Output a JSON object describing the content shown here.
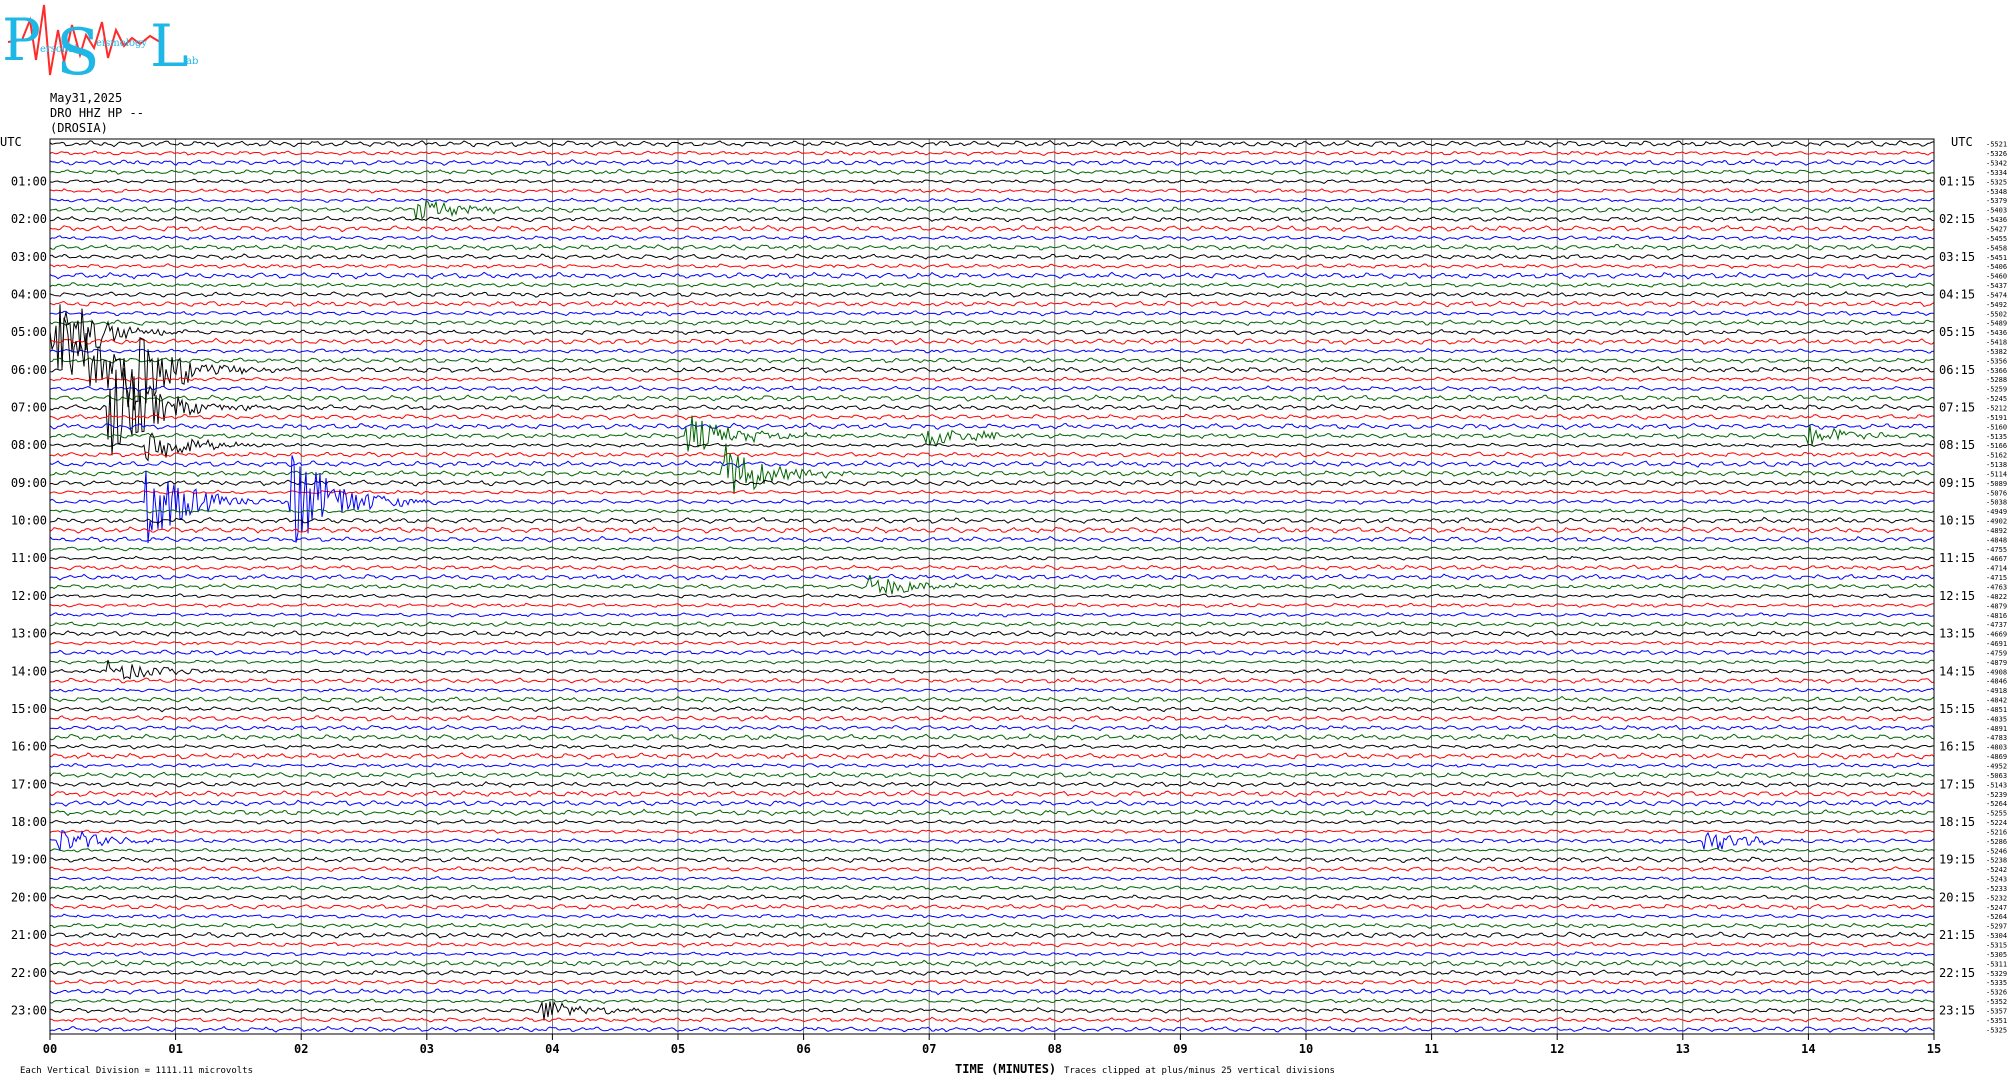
{
  "logo": {
    "initial_p": "P",
    "initial_s": "S",
    "initial_l": "L",
    "fragment_a": "ersonal",
    "fragment_b": "eismology",
    "fragment_c": "ab"
  },
  "header": {
    "date": "May31,2025",
    "channel": "DRO HHZ HP --",
    "station": "(DROSIA)"
  },
  "chart_data": {
    "type": "line",
    "title": "May31,2025 DRO HHZ HP -- (DROSIA)",
    "xlabel": "TIME (MINUTES)",
    "ylabel": "UTC",
    "xlim": [
      0,
      15
    ],
    "x_ticks": [
      "00",
      "01",
      "02",
      "03",
      "04",
      "05",
      "06",
      "07",
      "08",
      "09",
      "10",
      "11",
      "12",
      "13",
      "14",
      "15"
    ],
    "left_axis_label": "UTC",
    "right_axis_label": "UTC",
    "left_ticks": [
      "01:00",
      "02:00",
      "03:00",
      "04:00",
      "05:00",
      "06:00",
      "07:00",
      "08:00",
      "09:00",
      "10:00",
      "11:00",
      "12:00",
      "13:00",
      "14:00",
      "15:00",
      "16:00",
      "17:00",
      "18:00",
      "19:00",
      "20:00",
      "21:00",
      "22:00",
      "23:00"
    ],
    "right_ticks": [
      "01:15",
      "02:15",
      "03:15",
      "04:15",
      "05:15",
      "06:15",
      "07:15",
      "08:15",
      "09:15",
      "10:15",
      "11:15",
      "12:15",
      "13:15",
      "14:15",
      "15:15",
      "16:15",
      "17:15",
      "18:15",
      "19:15",
      "20:15",
      "21:15",
      "22:15",
      "23:15"
    ],
    "trace_colors": [
      "#000000",
      "#ff0000",
      "#0000ff",
      "#006400"
    ],
    "traces_per_hour": 4,
    "minutes_per_trace": 15,
    "trace_offsets": [
      "-5521",
      "-5326",
      "-5342",
      "-5334",
      "-5325",
      "-5348",
      "-5379",
      "-5403",
      "-5436",
      "-5427",
      "-5455",
      "-5458",
      "-5451",
      "-5406",
      "-5460",
      "-5437",
      "-5474",
      "-5492",
      "-5502",
      "-5489",
      "-5436",
      "-5418",
      "-5382",
      "-5356",
      "-5366",
      "-5288",
      "-5259",
      "-5245",
      "-5212",
      "-5191",
      "-5160",
      "-5135",
      "-5166",
      "-5162",
      "-5138",
      "-5114",
      "-5089",
      "-5076",
      "-5038",
      "-4949",
      "-4902",
      "-4892",
      "-4848",
      "-4755",
      "-4667",
      "-4714",
      "-4715",
      "-4763",
      "-4822",
      "-4879",
      "-4816",
      "-4737",
      "-4669",
      "-4691",
      "-4759",
      "-4879",
      "-4908",
      "-4846",
      "-4918",
      "-4842",
      "-4851",
      "-4835",
      "-4891",
      "-4783",
      "-4803",
      "-4869",
      "-4952",
      "-5063",
      "-5143",
      "-5239",
      "-5264",
      "-5255",
      "-5224",
      "-5216",
      "-5286",
      "-5246",
      "-5238",
      "-5242",
      "-5243",
      "-5233",
      "-5232",
      "-5247",
      "-5264",
      "-5297",
      "-5304",
      "-5315",
      "-5305",
      "-5311",
      "-5329",
      "-5335",
      "-5326",
      "-5352",
      "-5357",
      "-5351",
      "-5325"
    ],
    "events": [
      {
        "trace": 7,
        "minute": 2.95,
        "amplitude": 1.0
      },
      {
        "trace": 20,
        "minute": 0.05,
        "amplitude": 3.5
      },
      {
        "trace": 24,
        "minute": 0.15,
        "amplitude": 6.0
      },
      {
        "trace": 24,
        "minute": 0.65,
        "amplitude": 4.0
      },
      {
        "trace": 28,
        "minute": 0.5,
        "amplitude": 4.5
      },
      {
        "trace": 32,
        "minute": 0.8,
        "amplitude": 1.6
      },
      {
        "trace": 31,
        "minute": 5.1,
        "amplitude": 1.8
      },
      {
        "trace": 31,
        "minute": 7.0,
        "amplitude": 1.0
      },
      {
        "trace": 31,
        "minute": 14.0,
        "amplitude": 1.0
      },
      {
        "trace": 35,
        "minute": 5.4,
        "amplitude": 2.4
      },
      {
        "trace": 38,
        "minute": 0.8,
        "amplitude": 3.5
      },
      {
        "trace": 38,
        "minute": 1.95,
        "amplitude": 4.5
      },
      {
        "trace": 47,
        "minute": 6.55,
        "amplitude": 1.0
      },
      {
        "trace": 56,
        "minute": 0.5,
        "amplitude": 1.0
      },
      {
        "trace": 74,
        "minute": 0.1,
        "amplitude": 1.0
      },
      {
        "trace": 74,
        "minute": 13.2,
        "amplitude": 1.0
      },
      {
        "trace": 92,
        "minute": 3.95,
        "amplitude": 1.0
      }
    ]
  },
  "footer": {
    "scale": "Each Vertical Division = 1111.11 microvolts",
    "xlabel": "TIME (MINUTES)",
    "clip_note": "Traces clipped at plus/minus 25 vertical divisions"
  }
}
